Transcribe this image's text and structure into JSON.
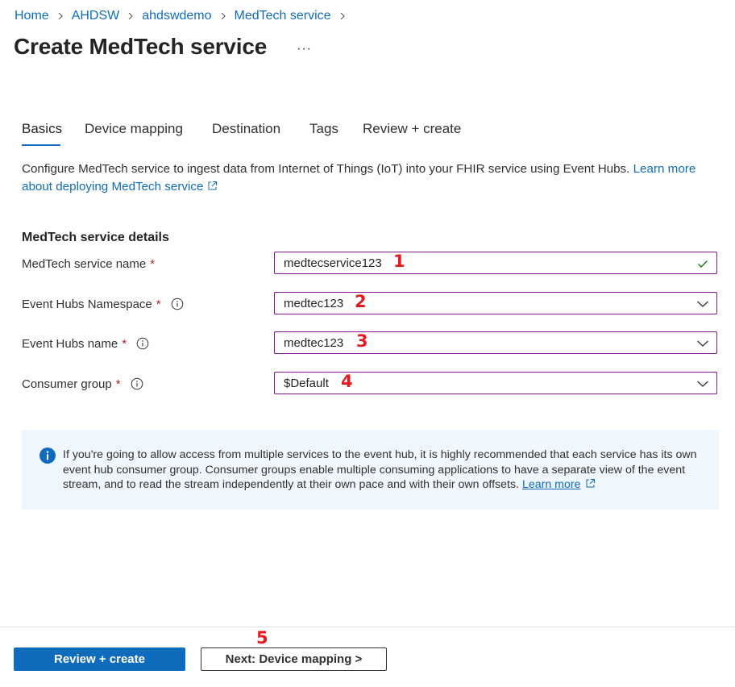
{
  "breadcrumb": [
    "Home",
    "AHDSW",
    "ahdswdemo",
    "MedTech service"
  ],
  "page": {
    "title": "Create MedTech service",
    "more": "···"
  },
  "tabs": [
    {
      "label": "Basics",
      "active": true
    },
    {
      "label": "Device mapping",
      "active": false
    },
    {
      "label": "Destination",
      "active": false
    },
    {
      "label": "Tags",
      "active": false
    },
    {
      "label": "Review + create",
      "active": false
    }
  ],
  "description": {
    "text": "Configure MedTech service to ingest data from Internet of Things (IoT) into your FHIR service using Event Hubs.",
    "link": "Learn more about deploying MedTech service"
  },
  "section": {
    "title": "MedTech service details"
  },
  "fields": {
    "service_name": {
      "label": "MedTech service name",
      "value": "medtecservice123",
      "marker": "1",
      "required": "*"
    },
    "namespace": {
      "label": "Event Hubs Namespace",
      "value": "medtec123",
      "marker": "2",
      "required": "*"
    },
    "hub_name": {
      "label": "Event Hubs name",
      "value": "medtec123",
      "marker": "3",
      "required": "*"
    },
    "consumer_group": {
      "label": "Consumer group",
      "value": "$Default",
      "marker": "4",
      "required": "*"
    }
  },
  "info": {
    "text": "If you're going to allow access from multiple services to the event hub, it is highly recommended that each service has its own event hub consumer group. Consumer groups enable multiple consuming applications to have a separate view of the event stream, and to read the stream independently at their own pace and with their own offsets.",
    "link": "Learn more"
  },
  "footer": {
    "review_create": "Review + create",
    "next": "Next: Device mapping >",
    "marker": "5"
  },
  "icons": {
    "chevron_right": "chevron-right-icon",
    "checkmark": "checkmark-icon",
    "chevron_down": "chevron-down-icon",
    "info": "info-icon",
    "external_link": "external-link-icon"
  },
  "colors": {
    "accent": "#0f6cbd",
    "required": "#a4262c",
    "annotation": "#e31c23",
    "focus_border": "#881798",
    "info_background": "#eff6fc",
    "valid": "#107c10"
  }
}
